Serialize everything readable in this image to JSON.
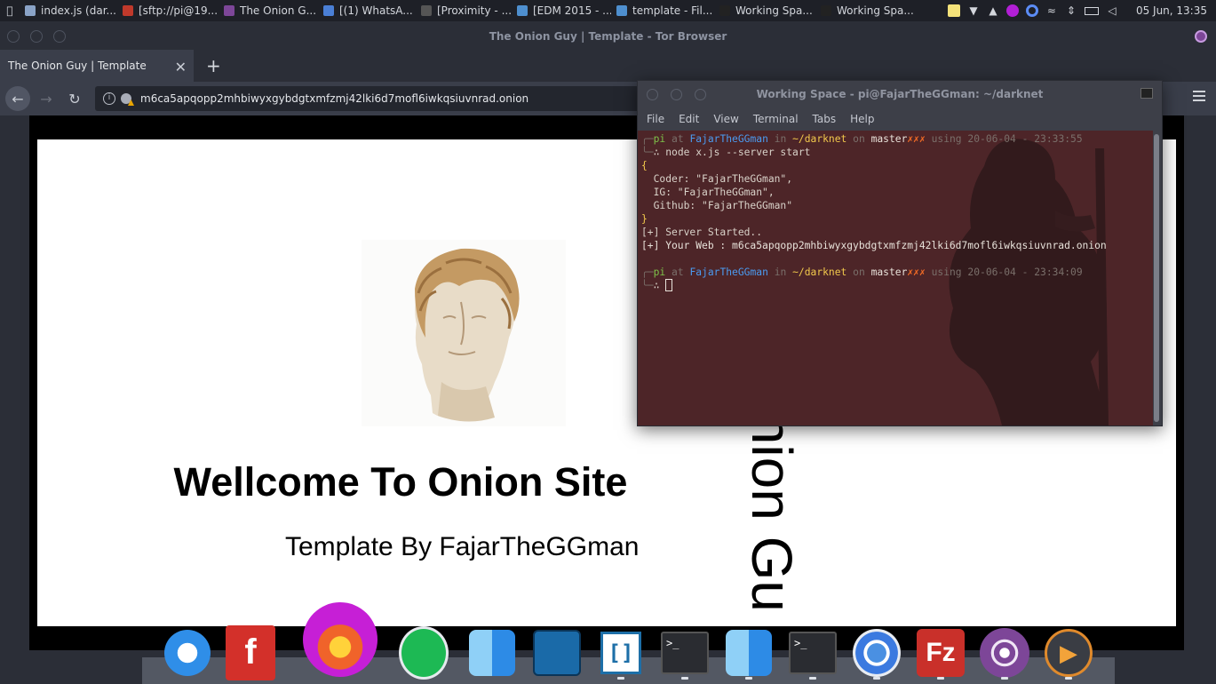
{
  "topbar": {
    "tasks": [
      {
        "label": "index.js (dar...",
        "icon": "text-editor-icon",
        "color": "#8aa3c7"
      },
      {
        "label": "[sftp://pi@19...",
        "icon": "filezilla-icon",
        "color": "#c0392b"
      },
      {
        "label": "The Onion G...",
        "icon": "tor-browser-icon",
        "color": "#7d4698"
      },
      {
        "label": "[(1) WhatsA...",
        "icon": "chrome-icon",
        "color": "#4a7fd6"
      },
      {
        "label": "[Proximity - ...",
        "icon": "youtube-icon",
        "color": "#555"
      },
      {
        "label": "[EDM 2015 - ...",
        "icon": "folder-icon",
        "color": "#4e8fcf"
      },
      {
        "label": "template - Fil...",
        "icon": "folder-icon",
        "color": "#4e8fcf"
      },
      {
        "label": "Working Spa...",
        "icon": "terminal-icon",
        "color": "#222"
      },
      {
        "label": "Working Spa...",
        "icon": "terminal-icon",
        "color": "#222"
      }
    ],
    "clock": "05 Jun, 13:35"
  },
  "browser": {
    "window_title": "The Onion Guy | Template - Tor Browser",
    "tab_title": "The Onion Guy | Template",
    "url": "m6ca5apqopp2mhbiwyxgybdgtxmfzmj42lki6d7mofl6iwkqsiuvnrad.onion"
  },
  "page": {
    "heading": "Wellcome To Onion Site",
    "subheading": "Template By FajarTheGGman",
    "vertical_text": "Onion Guy"
  },
  "terminal": {
    "title": "Working Space - pi@FajarTheGGman: ~/darknet",
    "menu": [
      "File",
      "Edit",
      "View",
      "Terminal",
      "Tabs",
      "Help"
    ],
    "prompt1": {
      "user": "pi",
      "at": "at",
      "host": "FajarTheGGman",
      "in": "in",
      "dir": "~/darknet",
      "on": "on",
      "branch": "master",
      "marks": "✗✗✗",
      "using": "using",
      "time": "20-06-04 - 23:33:55"
    },
    "command": "∴ node x.js --server start",
    "json_lines": [
      "{",
      "  Coder: \"FajarTheGGman\",",
      "  IG: \"FajarTheGGman\",",
      "  Github: \"FajarTheGGman\"",
      "}"
    ],
    "out1": "[+] Server Started..",
    "out2": "[+] Your Web : m6ca5apqopp2mhbiwyxgybdgtxmfzmj42lki6d7mofl6iwkqsiuvnrad.onion",
    "prompt2": {
      "user": "pi",
      "at": "at",
      "host": "FajarTheGGman",
      "in": "in",
      "dir": "~/darknet",
      "on": "on",
      "branch": "master",
      "marks": "✗✗✗",
      "using": "using",
      "time": "20-06-04 - 23:34:09"
    },
    "prompt2_symbol": "∴"
  },
  "dock": {
    "apps": [
      "safari-icon",
      "foxit-reader-icon",
      "flare-icon",
      "spotify-icon",
      "finder-icon",
      "wireshark-icon",
      "brackets-icon",
      "terminal-icon",
      "finder-icon",
      "terminal-icon",
      "chromium-icon",
      "filezilla-icon",
      "tor-browser-icon",
      "media-player-icon"
    ]
  }
}
